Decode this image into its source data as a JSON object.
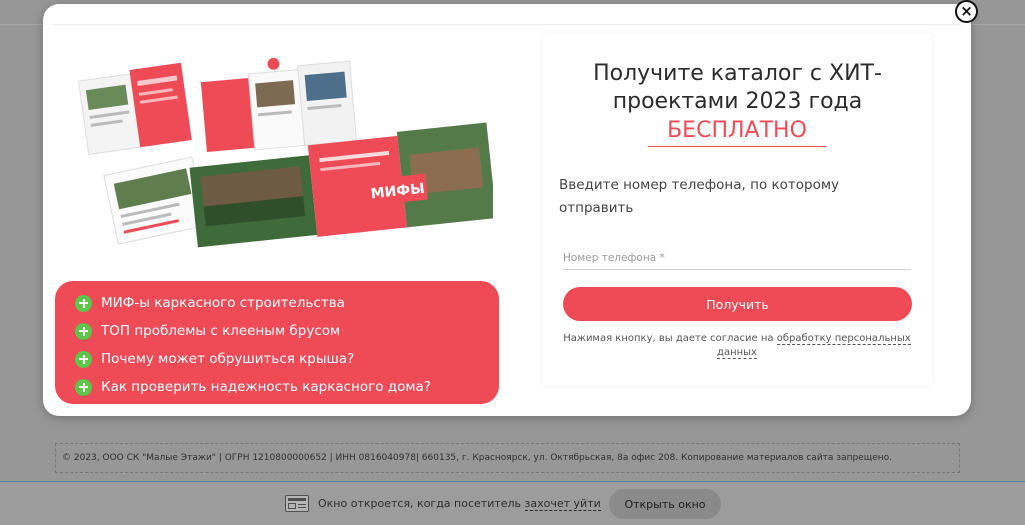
{
  "modal": {
    "close_glyph": "×",
    "topics": [
      "МИФ-ы каркасного строительства",
      "ТОП проблемы с клееным брусом",
      "Почему может обрушиться крыша?",
      "Как проверить надежность каркасного дома?"
    ],
    "form": {
      "title": "Получите каталог с ХИТ-проектами 2023 года",
      "title_highlight": "БЕСПЛАТНО",
      "description": "Введите номер телефона, по которому отправить",
      "phone_placeholder": "Номер телефона *",
      "phone_value": "",
      "submit_label": "Получить",
      "consent_prefix": "Нажимая кнопку, вы даете согласие на ",
      "consent_link": "обработку персональных данных"
    },
    "catalog_art": {
      "myths_label": "МИФЫ"
    }
  },
  "footer": {
    "copyright": "© 2023, ООО СК \"Малые Этажи\" | ОГРН 1210800000652 | ИНН 0816040978| 660135, г. Красноярск, ул. Октябрьская, 8а офис 208. Копирование материалов сайта запрещено."
  },
  "bottom_bar": {
    "text_prefix": "Окно откроется, когда посетитель ",
    "text_link": "захочет уйти",
    "open_label": "Открыть окно"
  },
  "colors": {
    "accent_red": "#ef4b57",
    "plus_green": "#5cc54a",
    "overlay_gray": "#979797"
  }
}
